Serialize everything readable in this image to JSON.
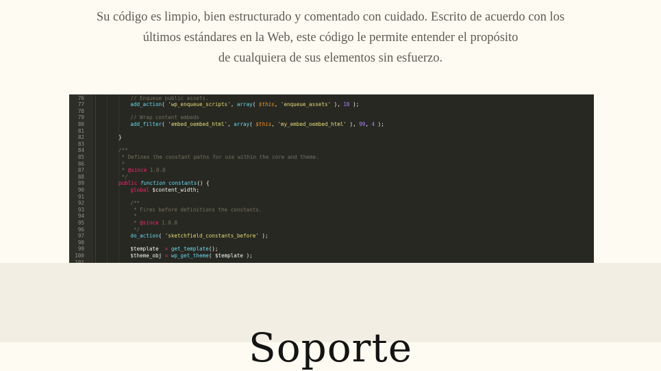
{
  "intro": {
    "line1": "Su código es limpio, bien estructurado y comentado con cuidado. Escrito de acuerdo con los",
    "line2": "últimos estándares en la Web, este código le permite entender el propósito",
    "line3": "de cualquiera de sus elementos sin esfuerzo."
  },
  "code_screenshot": {
    "lines": [
      {
        "n": "76",
        "indent": 2,
        "tokens": [
          {
            "c": "cm",
            "t": "// Enqueue public assets."
          }
        ]
      },
      {
        "n": "77",
        "indent": 2,
        "tokens": [
          {
            "c": "fn",
            "t": "add_action"
          },
          {
            "c": "",
            "t": "( "
          },
          {
            "c": "st",
            "t": "'wp_enqueue_scripts'"
          },
          {
            "c": "",
            "t": ", "
          },
          {
            "c": "fn",
            "t": "array"
          },
          {
            "c": "",
            "t": "( "
          },
          {
            "c": "va",
            "t": "$this"
          },
          {
            "c": "",
            "t": ", "
          },
          {
            "c": "st",
            "t": "'enqueue_assets'"
          },
          {
            "c": "",
            "t": " ), "
          },
          {
            "c": "nu",
            "t": "10"
          },
          {
            "c": "",
            "t": " );"
          }
        ]
      },
      {
        "n": "78",
        "indent": 0,
        "tokens": []
      },
      {
        "n": "79",
        "indent": 2,
        "tokens": [
          {
            "c": "cm",
            "t": "// Wrap content embeds"
          }
        ]
      },
      {
        "n": "80",
        "indent": 2,
        "tokens": [
          {
            "c": "fn",
            "t": "add_filter"
          },
          {
            "c": "",
            "t": "( "
          },
          {
            "c": "st",
            "t": "'embed_oembed_html'"
          },
          {
            "c": "",
            "t": ", "
          },
          {
            "c": "fn",
            "t": "array"
          },
          {
            "c": "",
            "t": "( "
          },
          {
            "c": "va",
            "t": "$this"
          },
          {
            "c": "",
            "t": ", "
          },
          {
            "c": "st",
            "t": "'my_embed_oembed_html'"
          },
          {
            "c": "",
            "t": " ), "
          },
          {
            "c": "nu",
            "t": "99"
          },
          {
            "c": "",
            "t": ", "
          },
          {
            "c": "nu",
            "t": "4"
          },
          {
            "c": "",
            "t": " );"
          }
        ]
      },
      {
        "n": "81",
        "indent": 0,
        "tokens": []
      },
      {
        "n": "82",
        "indent": 0,
        "tokens": [
          {
            "c": "",
            "t": "}"
          }
        ]
      },
      {
        "n": "83",
        "indent": 0,
        "tokens": []
      },
      {
        "n": "84",
        "indent": 0,
        "tokens": [
          {
            "c": "cm",
            "t": "/**"
          }
        ]
      },
      {
        "n": "85",
        "indent": 0,
        "tokens": [
          {
            "c": "cm",
            "t": " * Defines the constant paths for use within the core and theme."
          }
        ]
      },
      {
        "n": "86",
        "indent": 0,
        "tokens": [
          {
            "c": "cm",
            "t": " *"
          }
        ]
      },
      {
        "n": "87",
        "indent": 0,
        "tokens": [
          {
            "c": "cm",
            "t": " * "
          },
          {
            "c": "tag",
            "t": "@since"
          },
          {
            "c": "cm",
            "t": " 1.0.0"
          }
        ]
      },
      {
        "n": "88",
        "indent": 0,
        "tokens": [
          {
            "c": "cm",
            "t": " */"
          }
        ]
      },
      {
        "n": "89",
        "indent": 0,
        "tokens": [
          {
            "c": "kw",
            "t": "public"
          },
          {
            "c": "",
            "t": " "
          },
          {
            "c": "it",
            "t": "function"
          },
          {
            "c": "",
            "t": " "
          },
          {
            "c": "fn",
            "t": "constants"
          },
          {
            "c": "",
            "t": "() {"
          }
        ]
      },
      {
        "n": "90",
        "indent": 2,
        "tokens": [
          {
            "c": "kw",
            "t": "global"
          },
          {
            "c": "",
            "t": " $content_width;"
          }
        ]
      },
      {
        "n": "91",
        "indent": 0,
        "tokens": []
      },
      {
        "n": "92",
        "indent": 2,
        "tokens": [
          {
            "c": "cm",
            "t": "/**"
          }
        ]
      },
      {
        "n": "93",
        "indent": 2,
        "tokens": [
          {
            "c": "cm",
            "t": " * Fires before definitions the constants."
          }
        ]
      },
      {
        "n": "94",
        "indent": 2,
        "tokens": [
          {
            "c": "cm",
            "t": " *"
          }
        ]
      },
      {
        "n": "95",
        "indent": 2,
        "tokens": [
          {
            "c": "cm",
            "t": " * "
          },
          {
            "c": "tag",
            "t": "@since"
          },
          {
            "c": "cm",
            "t": " 1.0.0"
          }
        ]
      },
      {
        "n": "96",
        "indent": 2,
        "tokens": [
          {
            "c": "cm",
            "t": " */"
          }
        ]
      },
      {
        "n": "97",
        "indent": 2,
        "tokens": [
          {
            "c": "fn",
            "t": "do_action"
          },
          {
            "c": "",
            "t": "( "
          },
          {
            "c": "st",
            "t": "'sketchfield_constants_before'"
          },
          {
            "c": "",
            "t": " );"
          }
        ]
      },
      {
        "n": "98",
        "indent": 0,
        "tokens": []
      },
      {
        "n": "99",
        "indent": 2,
        "tokens": [
          {
            "c": "",
            "t": "$template  "
          },
          {
            "c": "kw",
            "t": "="
          },
          {
            "c": "",
            "t": " "
          },
          {
            "c": "fn",
            "t": "get_template"
          },
          {
            "c": "",
            "t": "();"
          }
        ]
      },
      {
        "n": "100",
        "indent": 2,
        "tokens": [
          {
            "c": "",
            "t": "$theme_obj "
          },
          {
            "c": "kw",
            "t": "="
          },
          {
            "c": "",
            "t": " "
          },
          {
            "c": "fn",
            "t": "wp_get_theme"
          },
          {
            "c": "",
            "t": "( $template );"
          }
        ]
      },
      {
        "n": "101",
        "indent": 0,
        "tokens": []
      }
    ]
  },
  "next_heading": "Soporte",
  "colors": {
    "page_bg": "#fdfbf2",
    "lower_section_bg": "#f2eee4",
    "code_bg": "#272822",
    "intro_text": "#5f5b52"
  }
}
